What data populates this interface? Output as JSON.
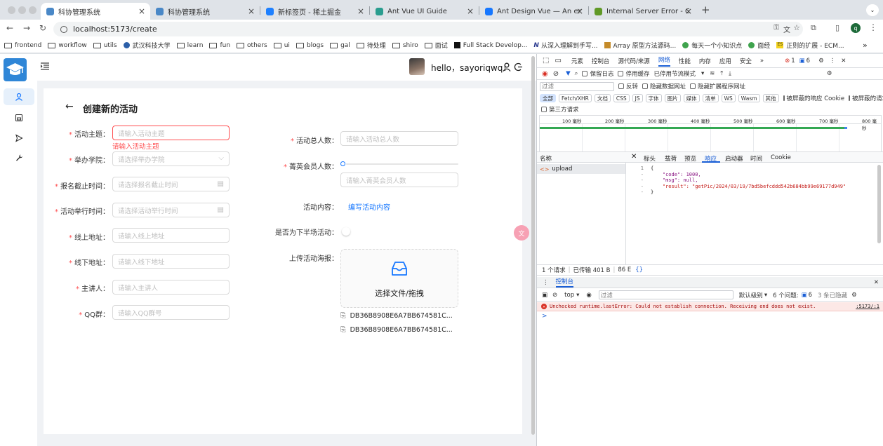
{
  "browser": {
    "tabs": [
      {
        "title": "科协管理系统",
        "active": true
      },
      {
        "title": "科协管理系统",
        "active": false
      },
      {
        "title": "新标签页 - 稀土掘金",
        "active": false
      },
      {
        "title": "Ant Vue UI Guide",
        "active": false
      },
      {
        "title": "Ant Design Vue — An enterpr",
        "active": false
      },
      {
        "title": "Internal Server Error - Gitea",
        "active": false
      }
    ],
    "url": "localhost:5173/create",
    "bookmarks": [
      "frontend",
      "workflow",
      "utils",
      "武汉科技大学",
      "learn",
      "fun",
      "others",
      "ui",
      "blogs",
      "gal",
      "待处理",
      "shiro",
      "面试",
      "Full Stack Develop...",
      "从深入理解到手写...",
      "Array 原型方法源码...",
      "每天一个小知识点",
      "面经",
      "正则的扩展 - ECM..."
    ]
  },
  "app": {
    "greeting": "hello，sayoriqwq！",
    "page_title": "创建新的活动",
    "accent": "#1677ff",
    "error_color": "#ff4d4f",
    "left_fields": [
      {
        "label": "活动主题：",
        "placeholder": "请输入活动主题",
        "required": true,
        "error": "请输入活动主题"
      },
      {
        "label": "举办学院：",
        "placeholder": "请选择举办学院",
        "required": true
      },
      {
        "label": "报名截止时间：",
        "placeholder": "请选择报名截止时间",
        "required": true
      },
      {
        "label": "活动举行时间：",
        "placeholder": "请选择活动举行时间",
        "required": true
      },
      {
        "label": "线上地址：",
        "placeholder": "请输入线上地址",
        "required": true
      },
      {
        "label": "线下地址：",
        "placeholder": "请输入线下地址",
        "required": true
      },
      {
        "label": "主讲人：",
        "placeholder": "请输入主讲人",
        "required": true
      },
      {
        "label": "QQ群：",
        "placeholder": "请输入QQ群号",
        "required": true
      }
    ],
    "right": {
      "total_label": "活动总人数：",
      "total_placeholder": "请输入活动总人数",
      "elite_label": "菁英会员人数：",
      "elite_placeholder": "请输入菁英会员人数",
      "content_label": "活动内容：",
      "content_link": "编写活动内容",
      "half_label": "是否为下半场活动：",
      "poster_label": "上传活动海报：",
      "upload_text": "选择文件/拖拽",
      "files": [
        "DB36B8908E6A7BB674581C...",
        "DB36B8908E6A7BB674581C..."
      ]
    }
  },
  "devtools": {
    "tabs": [
      "元素",
      "控制台",
      "源代码/来源",
      "网络",
      "性能",
      "内存",
      "应用",
      "安全"
    ],
    "active_tab": "网络",
    "error_count": "1",
    "msg_count": "6",
    "preserve_log": "保留日志",
    "disable_cache": "停用缓存",
    "throttle": "已停用节流模式",
    "filter_placeholder": "过滤",
    "invert": "反转",
    "hide_data": "隐藏数据网址",
    "hide_ext": "隐藏扩展程序网址",
    "types": [
      "全部",
      "Fetch/XHR",
      "文档",
      "CSS",
      "JS",
      "字体",
      "图片",
      "媒体",
      "清单",
      "WS",
      "Wasm",
      "其他"
    ],
    "blocked_cookies": "被屏蔽的响应 Cookie",
    "blocked_requests": "被屏蔽的请求",
    "third_party": "第三方请求",
    "timeline_ticks": [
      "100 毫秒",
      "200 毫秒",
      "300 毫秒",
      "400 毫秒",
      "500 毫秒",
      "600 毫秒",
      "700 毫秒",
      "800 毫秒"
    ],
    "name_header": "名称",
    "request_name": "upload",
    "detail_tabs": [
      "标头",
      "载荷",
      "预览",
      "响应",
      "启动器",
      "时间",
      "Cookie"
    ],
    "active_detail": "响应",
    "response_lines": [
      {
        "n": "1",
        "t": "{"
      },
      {
        "n": "-",
        "t": "    \"code\": 1000,"
      },
      {
        "n": "-",
        "t": "    \"msg\": null,"
      },
      {
        "n": "-",
        "t": "    \"result\": \"getPic/2024/03/19/7bd5befcddd542b684bb99e69177d949\""
      },
      {
        "n": "-",
        "t": "}"
      }
    ],
    "status_requests": "1 个请求",
    "status_transferred": "已传输 401 B",
    "status_resources": "86 E",
    "console_tab": "控制台",
    "context": "top",
    "console_filter": "过滤",
    "levels": "默认级别",
    "issues": "6 个问题:",
    "issues_count": "6",
    "hidden": "3 条已隐藏",
    "error_message": "Unchecked runtime.lastError: Could not establish connection. Receiving end does not exist.",
    "error_source": ":5173/:1",
    "prompt": ">"
  }
}
